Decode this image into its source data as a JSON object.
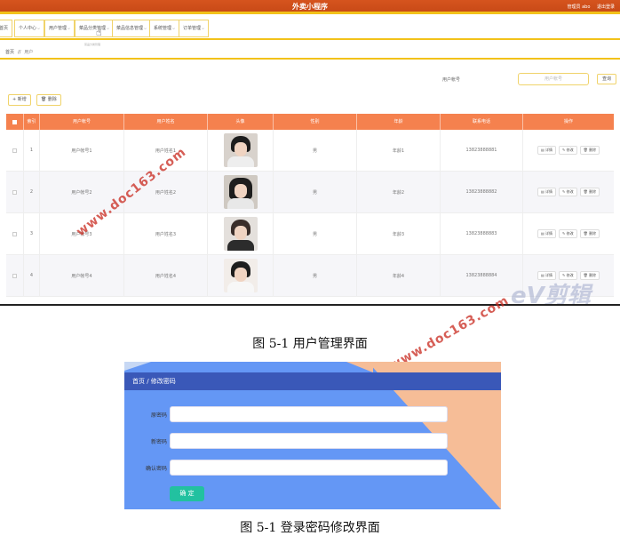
{
  "screenshot1": {
    "app_title": "外卖小程序",
    "user_info": {
      "role": "管理员 abo",
      "logout": "退出登录"
    },
    "nav": [
      "首页",
      "个人中心",
      "用户管理",
      "菜品分类管理",
      "菜品信息管理",
      "系统管理",
      "订单管理"
    ],
    "nav_hint": "菜品分类管理",
    "breadcrumb": {
      "home": "首页",
      "sep": "//",
      "current": "用户"
    },
    "search": {
      "label": "用户帐号",
      "placeholder": "用户帐号",
      "button": "查询"
    },
    "toolbar": {
      "add": "+ 新增",
      "delete": "🗑 删除"
    },
    "columns": [
      "",
      "索引",
      "用户帐号",
      "用户姓名",
      "头像",
      "性别",
      "年龄",
      "联系电话",
      "操作"
    ],
    "rows": [
      {
        "index": "1",
        "account": "用户帐号1",
        "name": "用户姓名1",
        "gender": "男",
        "age": "年龄1",
        "phone": "13823888881"
      },
      {
        "index": "2",
        "account": "用户帐号2",
        "name": "用户姓名2",
        "gender": "男",
        "age": "年龄2",
        "phone": "13823888882"
      },
      {
        "index": "3",
        "account": "用户帐号3",
        "name": "用户姓名3",
        "gender": "男",
        "age": "年龄3",
        "phone": "13823888883"
      },
      {
        "index": "4",
        "account": "用户帐号4",
        "name": "用户姓名4",
        "gender": "男",
        "age": "年龄4",
        "phone": "13823888884"
      }
    ],
    "row_ops": {
      "detail": "详情",
      "edit": "修改",
      "delete": "删除"
    },
    "watermark": "www.doc163.com",
    "logo_watermark": "eV剪辑"
  },
  "caption1": "图 5-1 用户管理界面",
  "screenshot2": {
    "breadcrumb": "首页 / 修改密码",
    "fields": [
      "原密码",
      "新密码",
      "确认密码"
    ],
    "submit": "确 定"
  },
  "caption2": "图 5-1 登录密码修改界面",
  "colors": {
    "header_orange": "#d6541e",
    "accent_yellow": "#f2c21a",
    "table_head": "#f5814e",
    "form_bg": "#6497f5",
    "form_header": "#3a58b8",
    "submit_green": "#22c1a0"
  }
}
